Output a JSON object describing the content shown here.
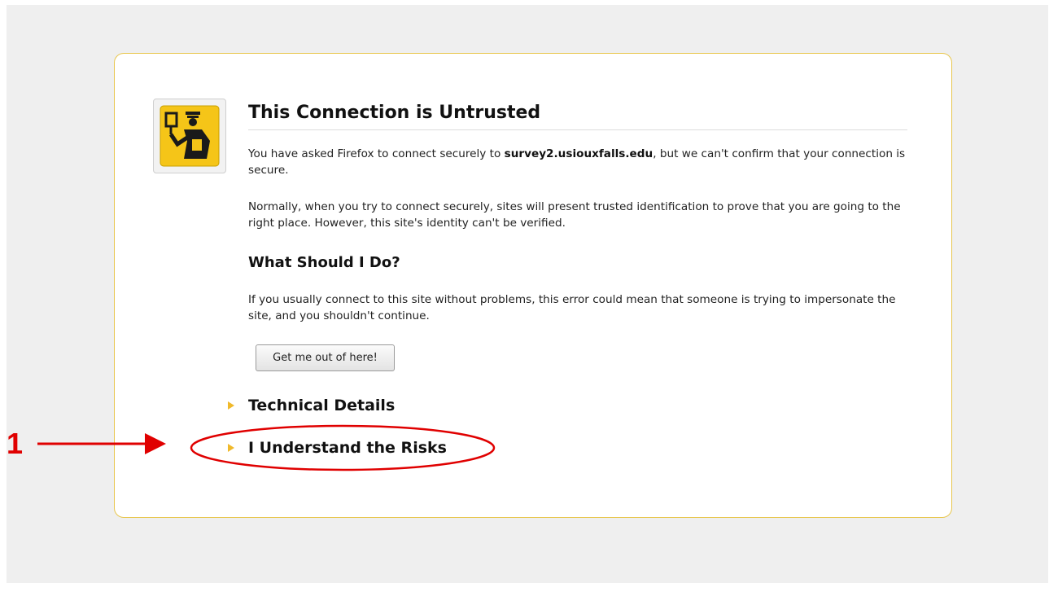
{
  "error_page": {
    "title": "This Connection is Untrusted",
    "intro": {
      "prefix": "You have asked Firefox to connect securely to ",
      "host": "survey2.usiouxfalls.edu",
      "suffix": ", but we can't confirm that your connection is secure."
    },
    "explanation": "Normally, when you try to connect securely, sites will present trusted identification to prove that you are going to the right place. However, this site's identity can't be verified.",
    "what_to_do_heading": "What Should I Do?",
    "what_to_do_text": "If you usually connect to this site without problems, this error could mean that someone is trying to impersonate the site, and you shouldn't continue.",
    "get_out_button": "Get me out of here!",
    "technical_details": "Technical Details",
    "understand_risks": "I Understand the Risks"
  },
  "annotation": {
    "number": "1",
    "color": "#e00000"
  },
  "icons": {
    "certificate": "certificate-officer-icon",
    "expander": "triangle-right-icon"
  },
  "colors": {
    "box_border": "#e8c64d",
    "icon_yellow": "#f5c518",
    "expander_triangle": "#f0b92b"
  }
}
